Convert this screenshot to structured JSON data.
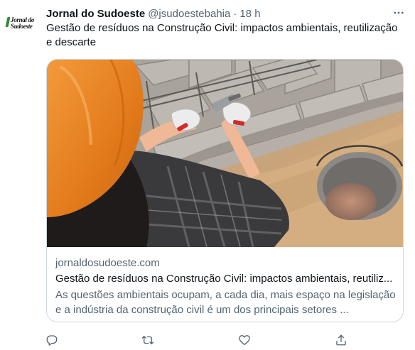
{
  "author": {
    "display_name": "Jornal do Sudoeste",
    "handle": "@jsudoestebahia",
    "separator": "·",
    "time": "18 h",
    "avatar_logo_line1": "Jornal do",
    "avatar_logo_line2": "Sudoeste"
  },
  "tweet": {
    "text": "Gestão de resíduos na Construção Civil: impactos ambientais, reutilização e descarte"
  },
  "card": {
    "domain": "jornaldosudoeste.com",
    "title": "Gestão de resíduos na Construção Civil: impactos ambientais, reutiliz...",
    "description": "As questões ambientais ocupam, a cada dia, mais espaço na legislação e a indústria da construção civil é um dos principais setores ..."
  },
  "icons": {
    "more": "more-horizontal-icon",
    "reply": "reply-icon",
    "retweet": "retweet-icon",
    "like": "like-heart-icon",
    "share": "share-icon"
  },
  "colors": {
    "text_primary": "#0f1419",
    "text_secondary": "#536471",
    "border": "#cfd9de",
    "avatar_mark": "#2e8b3a"
  }
}
